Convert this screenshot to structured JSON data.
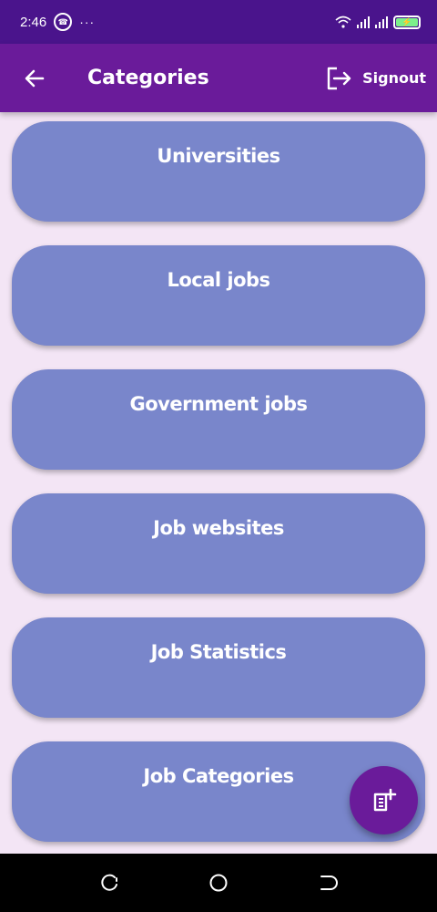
{
  "status_bar": {
    "time": "2:46",
    "icons": [
      "whatsapp-icon",
      "more-dots-icon",
      "wifi-icon",
      "signal-icon",
      "signal-icon",
      "battery-charging-icon"
    ]
  },
  "app_bar": {
    "title": "Categories",
    "signout_label": "Signout"
  },
  "categories": [
    {
      "label": "Universities"
    },
    {
      "label": "Local jobs"
    },
    {
      "label": "Government jobs"
    },
    {
      "label": "Job websites"
    },
    {
      "label": "Job Statistics"
    },
    {
      "label": "Job Categories"
    }
  ],
  "fab": {
    "icon": "note-add-icon"
  },
  "nav_bar": {
    "icons": [
      "recents-icon",
      "home-icon",
      "back-icon"
    ]
  },
  "colors": {
    "status_bar": "#4a148c",
    "app_bar": "#6a1b9a",
    "card": "#7986cb",
    "background": "#f3e5f5",
    "fab": "#6a1b9a"
  }
}
